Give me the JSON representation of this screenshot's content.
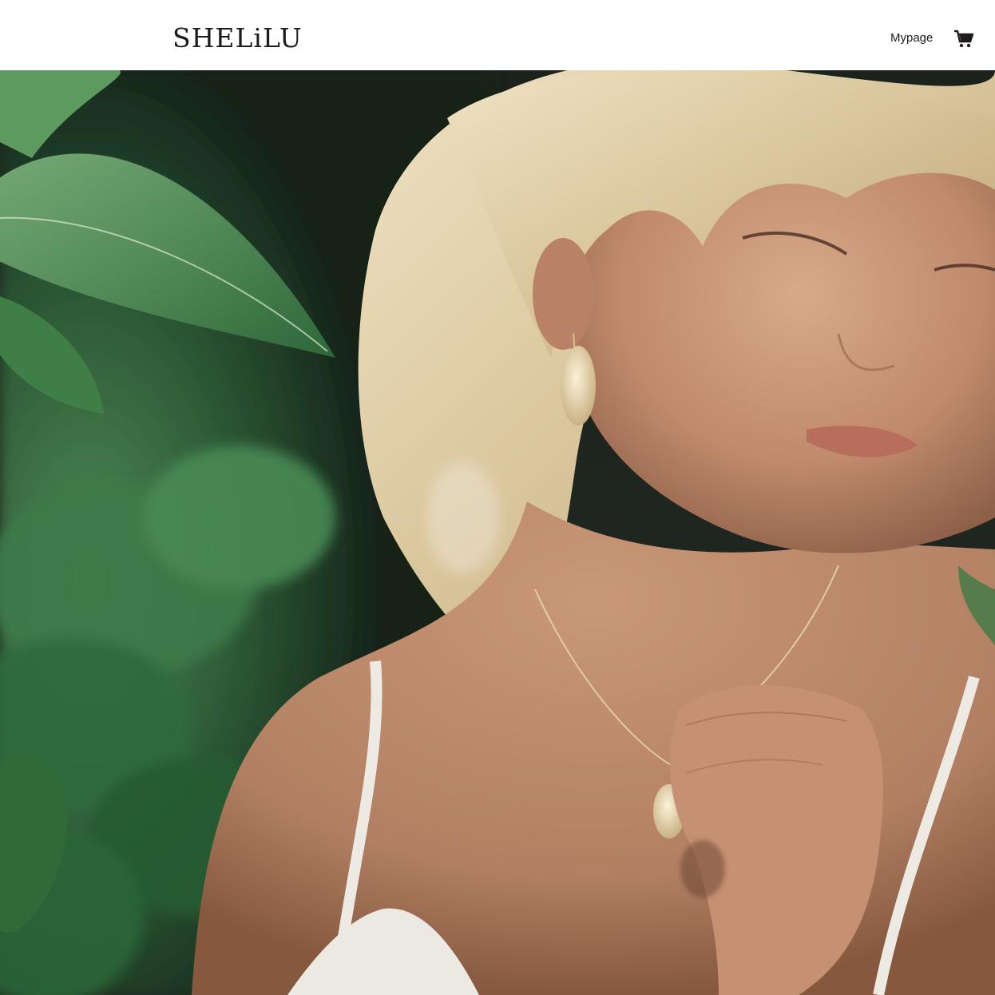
{
  "header": {
    "logo_text": "SHELiLU",
    "mypage_label": "Mypage",
    "cart_icon": "cart-icon"
  },
  "hero": {
    "image": "woman-with-shell-earring-and-necklace-among-leaves"
  },
  "colors": {
    "header_bg": "#ffffff",
    "text": "#1e1b1a",
    "leaf_green": "#3f7a45",
    "shadow_dark": "#151a16"
  }
}
